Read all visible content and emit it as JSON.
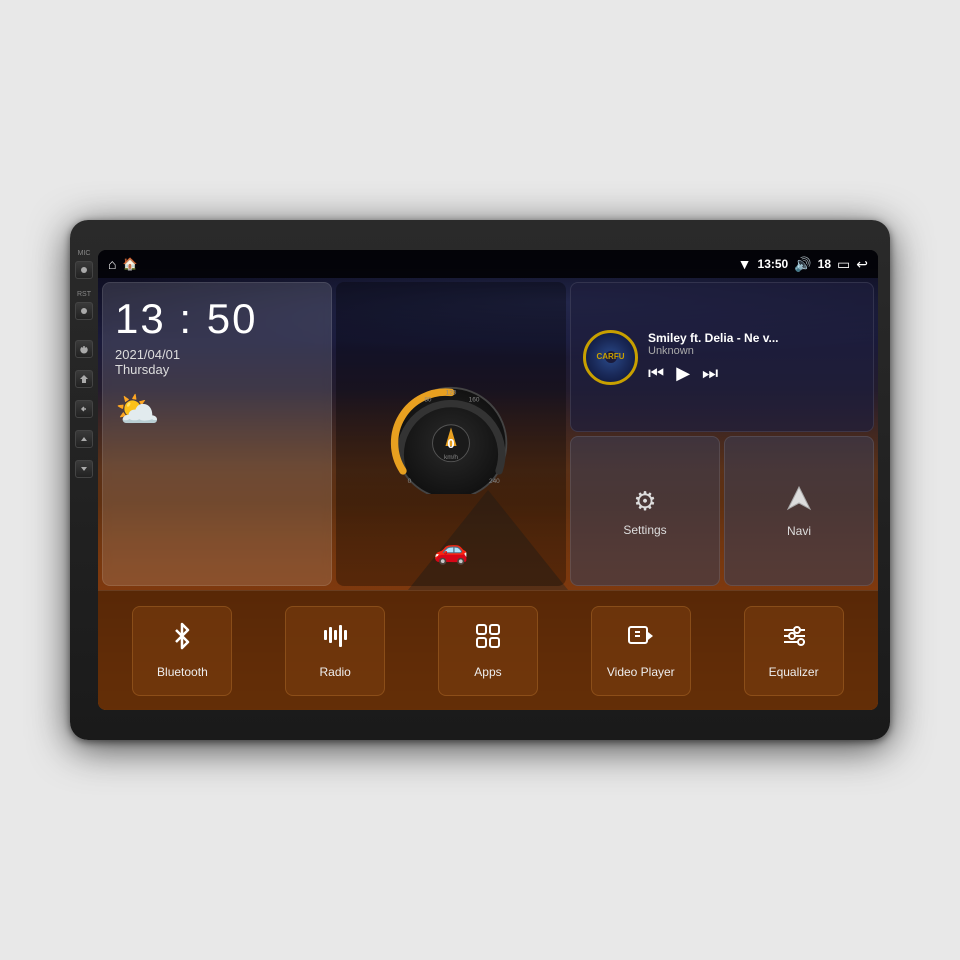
{
  "stereo": {
    "status_bar": {
      "home_icon": "⌂",
      "app_icon": "🏠",
      "wifi_icon": "▼",
      "time": "13:50",
      "volume_icon": "🔊",
      "volume_level": "18",
      "battery_icon": "▭",
      "back_icon": "↩"
    },
    "clock_widget": {
      "time": "13 : 50",
      "date": "2021/04/01",
      "day": "Thursday",
      "weather": "⛅"
    },
    "music_widget": {
      "title": "Smiley ft. Delia - Ne v...",
      "artist": "Unknown",
      "logo_text": "CARFU",
      "prev": "⏮",
      "play": "▶",
      "next": "⏭"
    },
    "settings_button": {
      "label": "Settings",
      "icon": "⚙"
    },
    "navi_button": {
      "label": "Navi",
      "icon": "▲"
    },
    "bottom_apps": [
      {
        "id": "bluetooth",
        "label": "Bluetooth",
        "icon": "bluetooth"
      },
      {
        "id": "radio",
        "label": "Radio",
        "icon": "radio"
      },
      {
        "id": "apps",
        "label": "Apps",
        "icon": "apps"
      },
      {
        "id": "video-player",
        "label": "Video Player",
        "icon": "video"
      },
      {
        "id": "equalizer",
        "label": "Equalizer",
        "icon": "equalizer"
      }
    ],
    "side_buttons": [
      {
        "id": "mic",
        "label": "MIC"
      },
      {
        "id": "rst",
        "label": "RST"
      },
      {
        "id": "power",
        "label": ""
      },
      {
        "id": "home",
        "label": ""
      },
      {
        "id": "back",
        "label": ""
      },
      {
        "id": "vol-up",
        "label": ""
      },
      {
        "id": "vol-down",
        "label": ""
      }
    ]
  }
}
